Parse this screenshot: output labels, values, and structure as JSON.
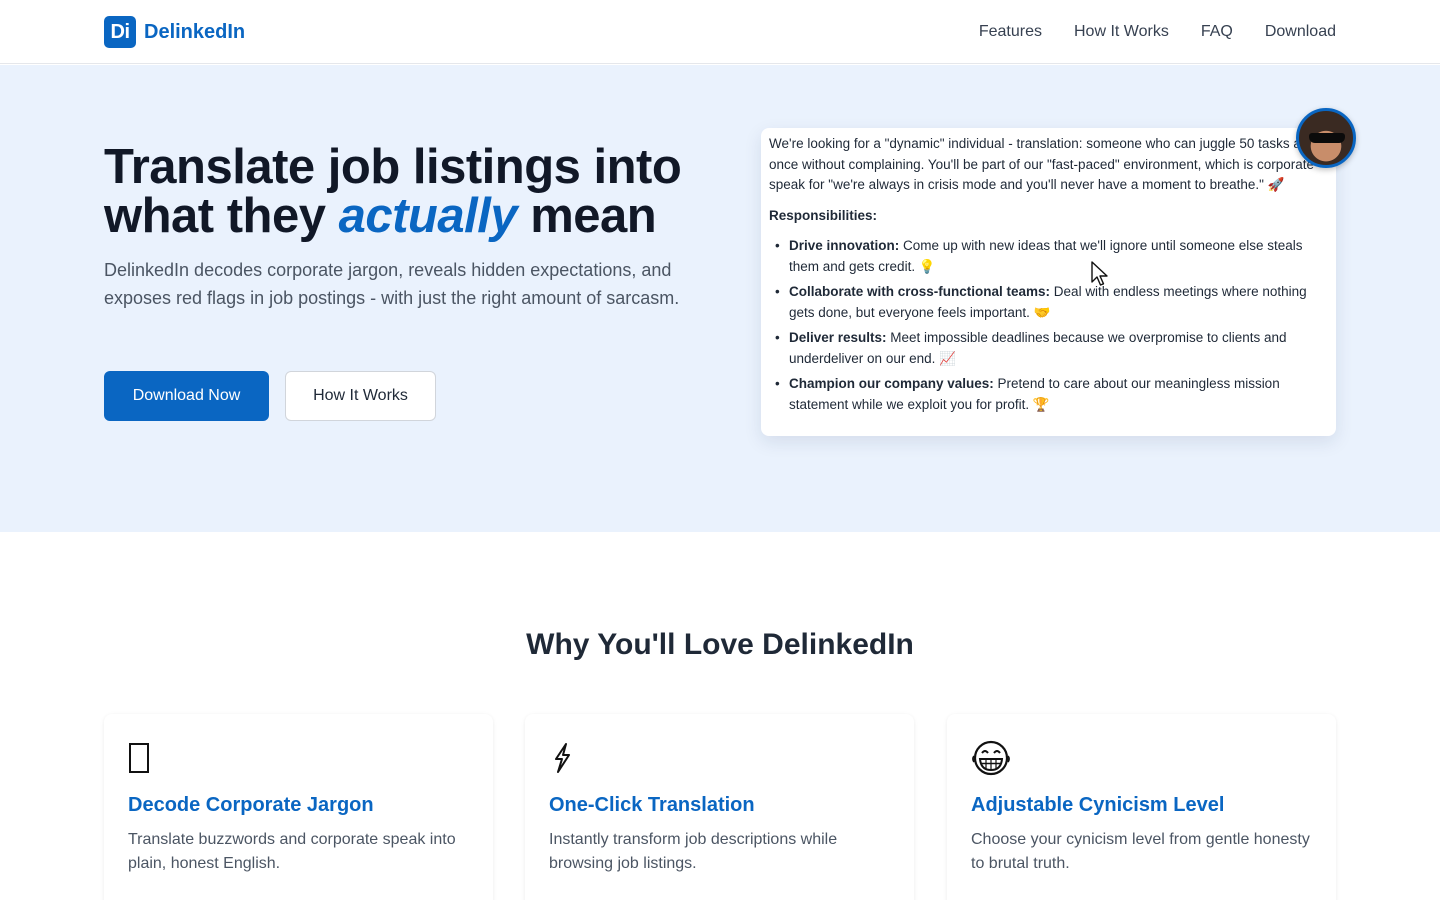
{
  "brand": {
    "logo_mark": "Di",
    "name": "DelinkedIn",
    "color": "#0a66c2"
  },
  "nav": {
    "items": [
      "Features",
      "How It Works",
      "FAQ",
      "Download"
    ]
  },
  "hero": {
    "title_line1": "Translate job listings into",
    "title_line2_pre": "what they ",
    "title_emph": "actually",
    "title_line2_post": " mean",
    "subtitle": "DelinkedIn decodes corporate jargon, reveals hidden expectations, and exposes red flags in job postings - with just the right amount of sarcasm.",
    "primary_button": "Download Now",
    "secondary_button": "How It Works",
    "background": "#eaf2fd"
  },
  "preview": {
    "intro": "We're looking for a \"dynamic\" individual - translation: someone who can juggle 50 tasks at once without complaining. You'll be part of our \"fast-paced\" environment, which is corporate speak for \"we're always in crisis mode and you'll never have a moment to breathe.\" 🚀",
    "responsibilities_label": "Responsibilities:",
    "items": [
      {
        "label": "Drive innovation:",
        "text": " Come up with new ideas that we'll ignore until someone else steals them and gets credit. 💡"
      },
      {
        "label": "Collaborate with cross-functional teams:",
        "text": " Deal with endless meetings where nothing gets done, but everyone feels important. 🤝"
      },
      {
        "label": "Deliver results:",
        "text": " Meet impossible deadlines because we overpromise to clients and underdeliver on our end. 📈"
      },
      {
        "label": "Champion our company values:",
        "text": " Pretend to care about our meaningless mission statement while we exploit you for profit. 🏆"
      }
    ]
  },
  "features": {
    "title": "Why You'll Love DelinkedIn",
    "cards": [
      {
        "icon": "missing-glyph-icon",
        "title": "Decode Corporate Jargon",
        "desc": "Translate buzzwords and corporate speak into plain, honest English."
      },
      {
        "icon": "lightning-icon",
        "title": "One-Click Translation",
        "desc": "Instantly transform job descriptions while browsing job listings."
      },
      {
        "icon": "grinning-face-icon",
        "title": "Adjustable Cynicism Level",
        "desc": "Choose your cynicism level from gentle honesty to brutal truth."
      }
    ]
  }
}
